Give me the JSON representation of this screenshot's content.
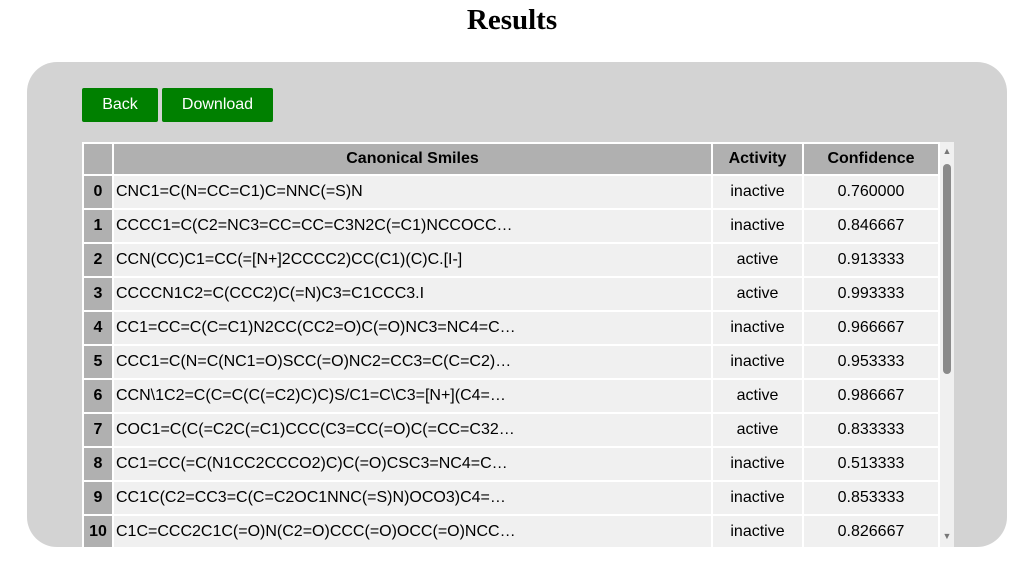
{
  "page": {
    "title": "Results"
  },
  "toolbar": {
    "back_label": "Back",
    "download_label": "Download"
  },
  "table": {
    "headers": {
      "index": "",
      "smiles": "Canonical Smiles",
      "activity": "Activity",
      "confidence": "Confidence"
    },
    "rows": [
      {
        "index": "0",
        "smiles": "CNC1=C(N=CC=C1)C=NNC(=S)N",
        "activity": "inactive",
        "confidence": "0.760000"
      },
      {
        "index": "1",
        "smiles": "CCCC1=C(C2=NC3=CC=CC=C3N2C(=C1)NCCOCC…",
        "activity": "inactive",
        "confidence": "0.846667"
      },
      {
        "index": "2",
        "smiles": "CCN(CC)C1=CC(=[N+]2CCCC2)CC(C1)(C)C.[I-]",
        "activity": "active",
        "confidence": "0.913333"
      },
      {
        "index": "3",
        "smiles": "CCCCN1C2=C(CCC2)C(=N)C3=C1CCC3.I",
        "activity": "active",
        "confidence": "0.993333"
      },
      {
        "index": "4",
        "smiles": "CC1=CC=C(C=C1)N2CC(CC2=O)C(=O)NC3=NC4=C…",
        "activity": "inactive",
        "confidence": "0.966667"
      },
      {
        "index": "5",
        "smiles": "CCC1=C(N=C(NC1=O)SCC(=O)NC2=CC3=C(C=C2)…",
        "activity": "inactive",
        "confidence": "0.953333"
      },
      {
        "index": "6",
        "smiles": "CCN\\1C2=C(C=C(C(=C2)C)C)S/C1=C\\C3=[N+](C4=…",
        "activity": "active",
        "confidence": "0.986667"
      },
      {
        "index": "7",
        "smiles": "COC1=C(C(=C2C(=C1)CCC(C3=CC(=O)C(=CC=C32…",
        "activity": "active",
        "confidence": "0.833333"
      },
      {
        "index": "8",
        "smiles": "CC1=CC(=C(N1CC2CCCO2)C)C(=O)CSC3=NC4=C…",
        "activity": "inactive",
        "confidence": "0.513333"
      },
      {
        "index": "9",
        "smiles": "CC1C(C2=CC3=C(C=C2OC1NNC(=S)N)OCO3)C4=…",
        "activity": "inactive",
        "confidence": "0.853333"
      },
      {
        "index": "10",
        "smiles": "C1C=CCC2C1C(=O)N(C2=O)CCC(=O)OCC(=O)NCC…",
        "activity": "inactive",
        "confidence": "0.826667"
      }
    ]
  },
  "scrollbar": {
    "up_icon": "▲",
    "down_icon": "▼"
  },
  "colors": {
    "button": "#008000",
    "panel": "#d3d3d3",
    "header": "#b0b0b0",
    "cell": "#f0f0f0"
  }
}
